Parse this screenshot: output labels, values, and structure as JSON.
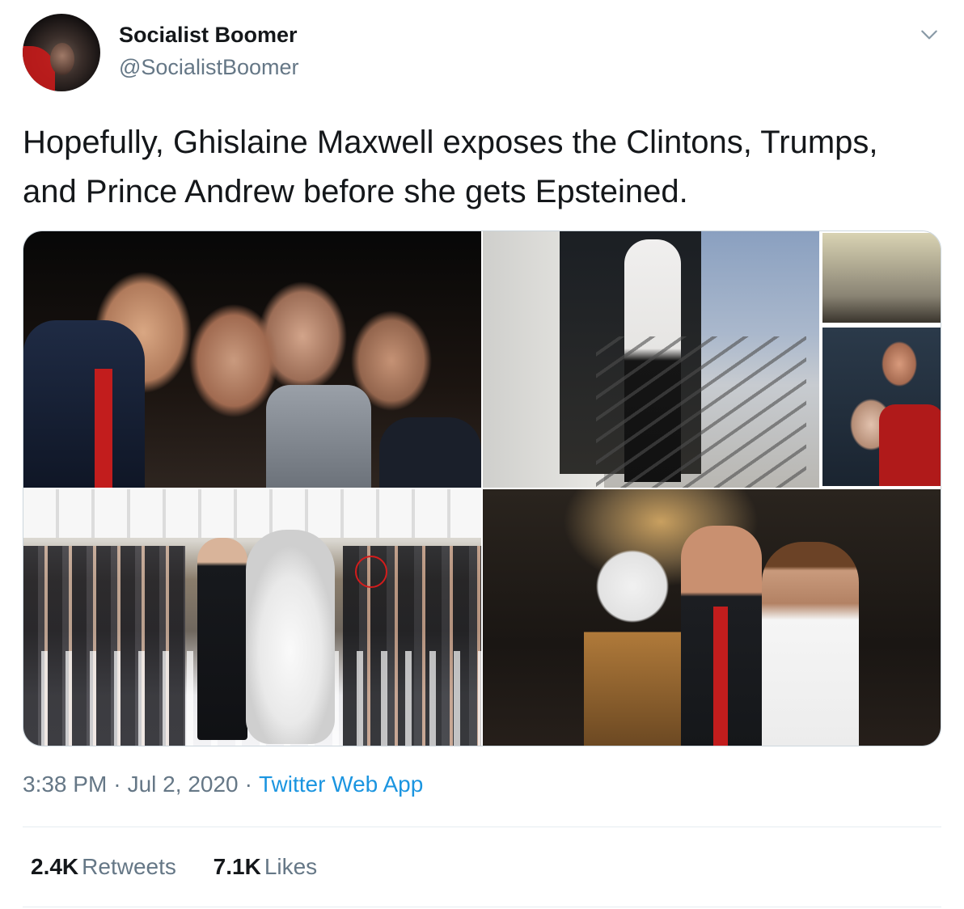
{
  "author": {
    "display_name": "Socialist Boomer",
    "handle": "@SocialistBoomer",
    "avatar_icon": "profile-avatar"
  },
  "menu_icon": "chevron-down-icon",
  "tweet": {
    "text": "Hopefully, Ghislaine Maxwell exposes the Clintons, Trumps, and Prince Andrew before she gets Epsteined."
  },
  "meta": {
    "time": "3:38 PM",
    "separator": "·",
    "date": "Jul 2, 2020",
    "source": "Twitter Web App"
  },
  "stats": {
    "retweets_count": "2.4K",
    "retweets_label": "Retweets",
    "likes_count": "7.1K",
    "likes_label": "Likes"
  },
  "colors": {
    "text": "#14171a",
    "secondary": "#657786",
    "link": "#1b95e0",
    "divider": "#e6ecf0"
  }
}
